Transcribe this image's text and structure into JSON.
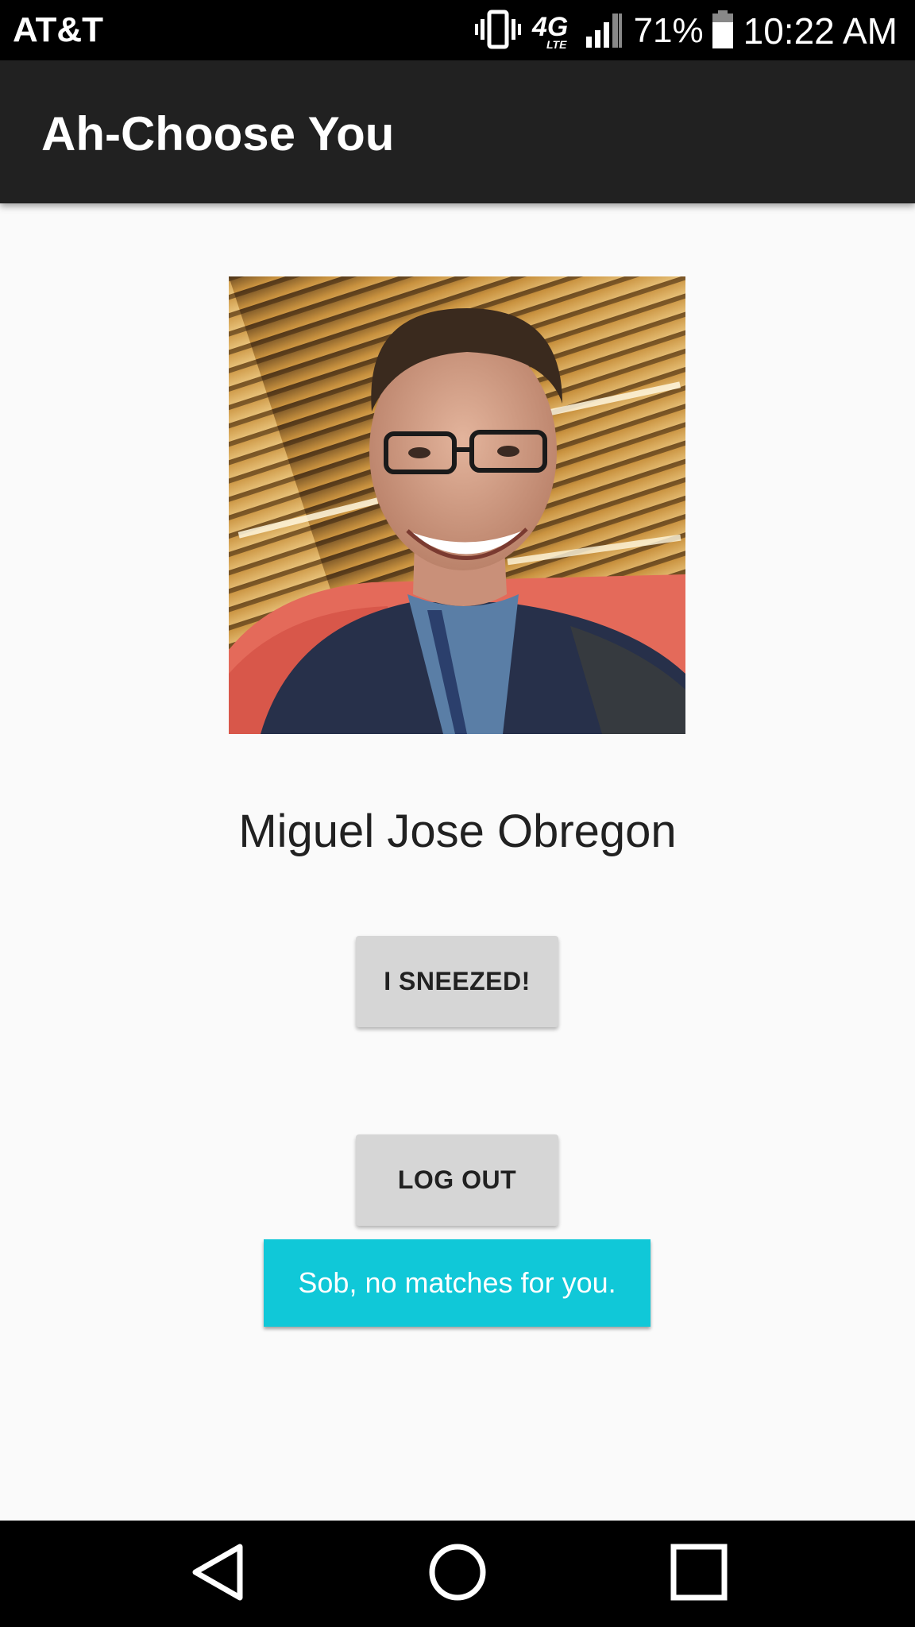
{
  "status_bar": {
    "carrier": "AT&T",
    "network_type": "4G LTE",
    "network_main": "4G",
    "network_sub": "LTE",
    "battery_percent": "71%",
    "time": "10:22 AM",
    "icons": [
      "vibrate-icon",
      "network-4g-lte-icon",
      "signal-icon",
      "battery-icon"
    ]
  },
  "app_bar": {
    "title": "Ah-Choose You"
  },
  "profile": {
    "name": "Miguel Jose Obregon",
    "photo": "profile-photo"
  },
  "actions": {
    "sneeze_label": "I SNEEZED!",
    "logout_label": "LOG OUT"
  },
  "toast": {
    "message": "Sob, no matches for you."
  },
  "nav_bar": {
    "icons": [
      "back-icon",
      "home-icon",
      "recents-icon"
    ]
  },
  "colors": {
    "status_bar": "#000000",
    "app_bar": "#212121",
    "background": "#fafafa",
    "button": "#d6d6d6",
    "toast": "#10c8d8",
    "text_primary": "#212121"
  }
}
